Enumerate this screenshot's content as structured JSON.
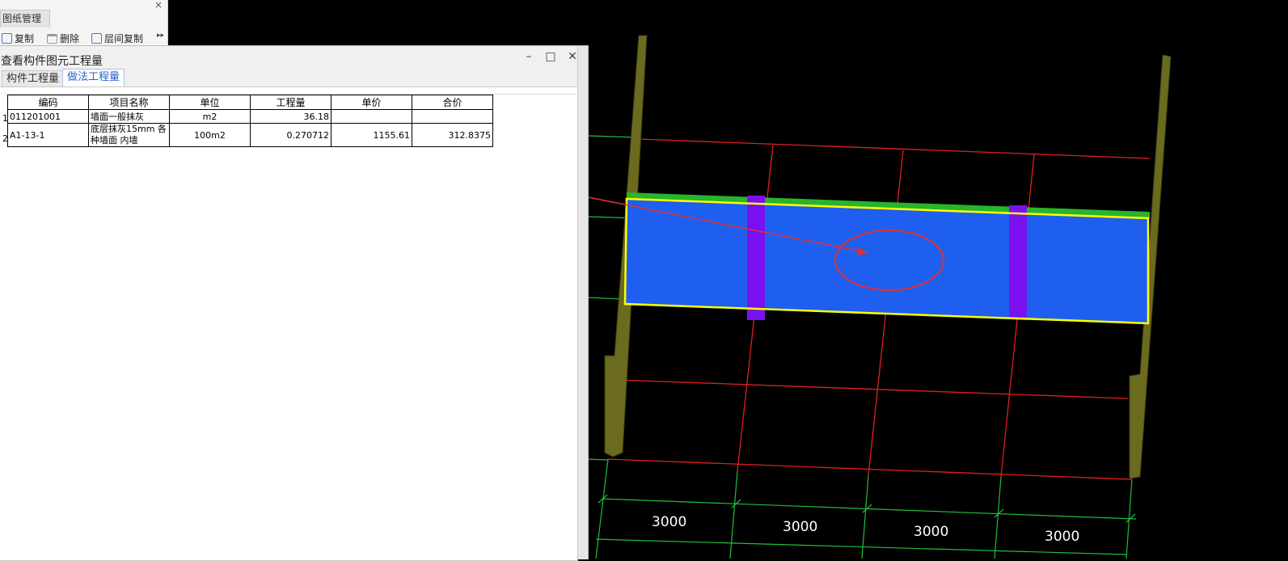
{
  "drawing_manager": {
    "tab_label": "图纸管理",
    "toolbar": {
      "copy": "复制",
      "delete": "删除",
      "floor_copy": "层间复制"
    }
  },
  "dialog": {
    "title": "查看构件图元工程量",
    "tabs": [
      {
        "label": "构件工程量",
        "active": false
      },
      {
        "label": "做法工程量",
        "active": true
      }
    ],
    "table": {
      "headers": [
        "编码",
        "项目名称",
        "单位",
        "工程量",
        "单价",
        "合价"
      ],
      "rows": [
        {
          "index": "1",
          "code": "011201001",
          "name": "墙面一般抹灰",
          "unit": "m2",
          "quantity": "36.18",
          "unit_price": "",
          "total": ""
        },
        {
          "index": "2",
          "code": "A1-13-1",
          "name_line1": "底层抹灰15mm 各",
          "name_line2": "种墙面 内墙",
          "unit": "100m2",
          "quantity": "0.270712",
          "unit_price": "1155.61",
          "total": "312.8375"
        }
      ]
    }
  },
  "viewport": {
    "dimension_labels": [
      "3000",
      "3000",
      "3000",
      "3000"
    ],
    "colors": {
      "background": "#000000",
      "grid_axis": "#e02020",
      "dimension_lines": "#1fbf3a",
      "wall_face": "#1e5fef",
      "wall_top": "#27b52b",
      "column": "#7a10f0",
      "selection": "#ffff00",
      "side_walls": "#6b6b1f",
      "annotation": "#e03030"
    }
  }
}
